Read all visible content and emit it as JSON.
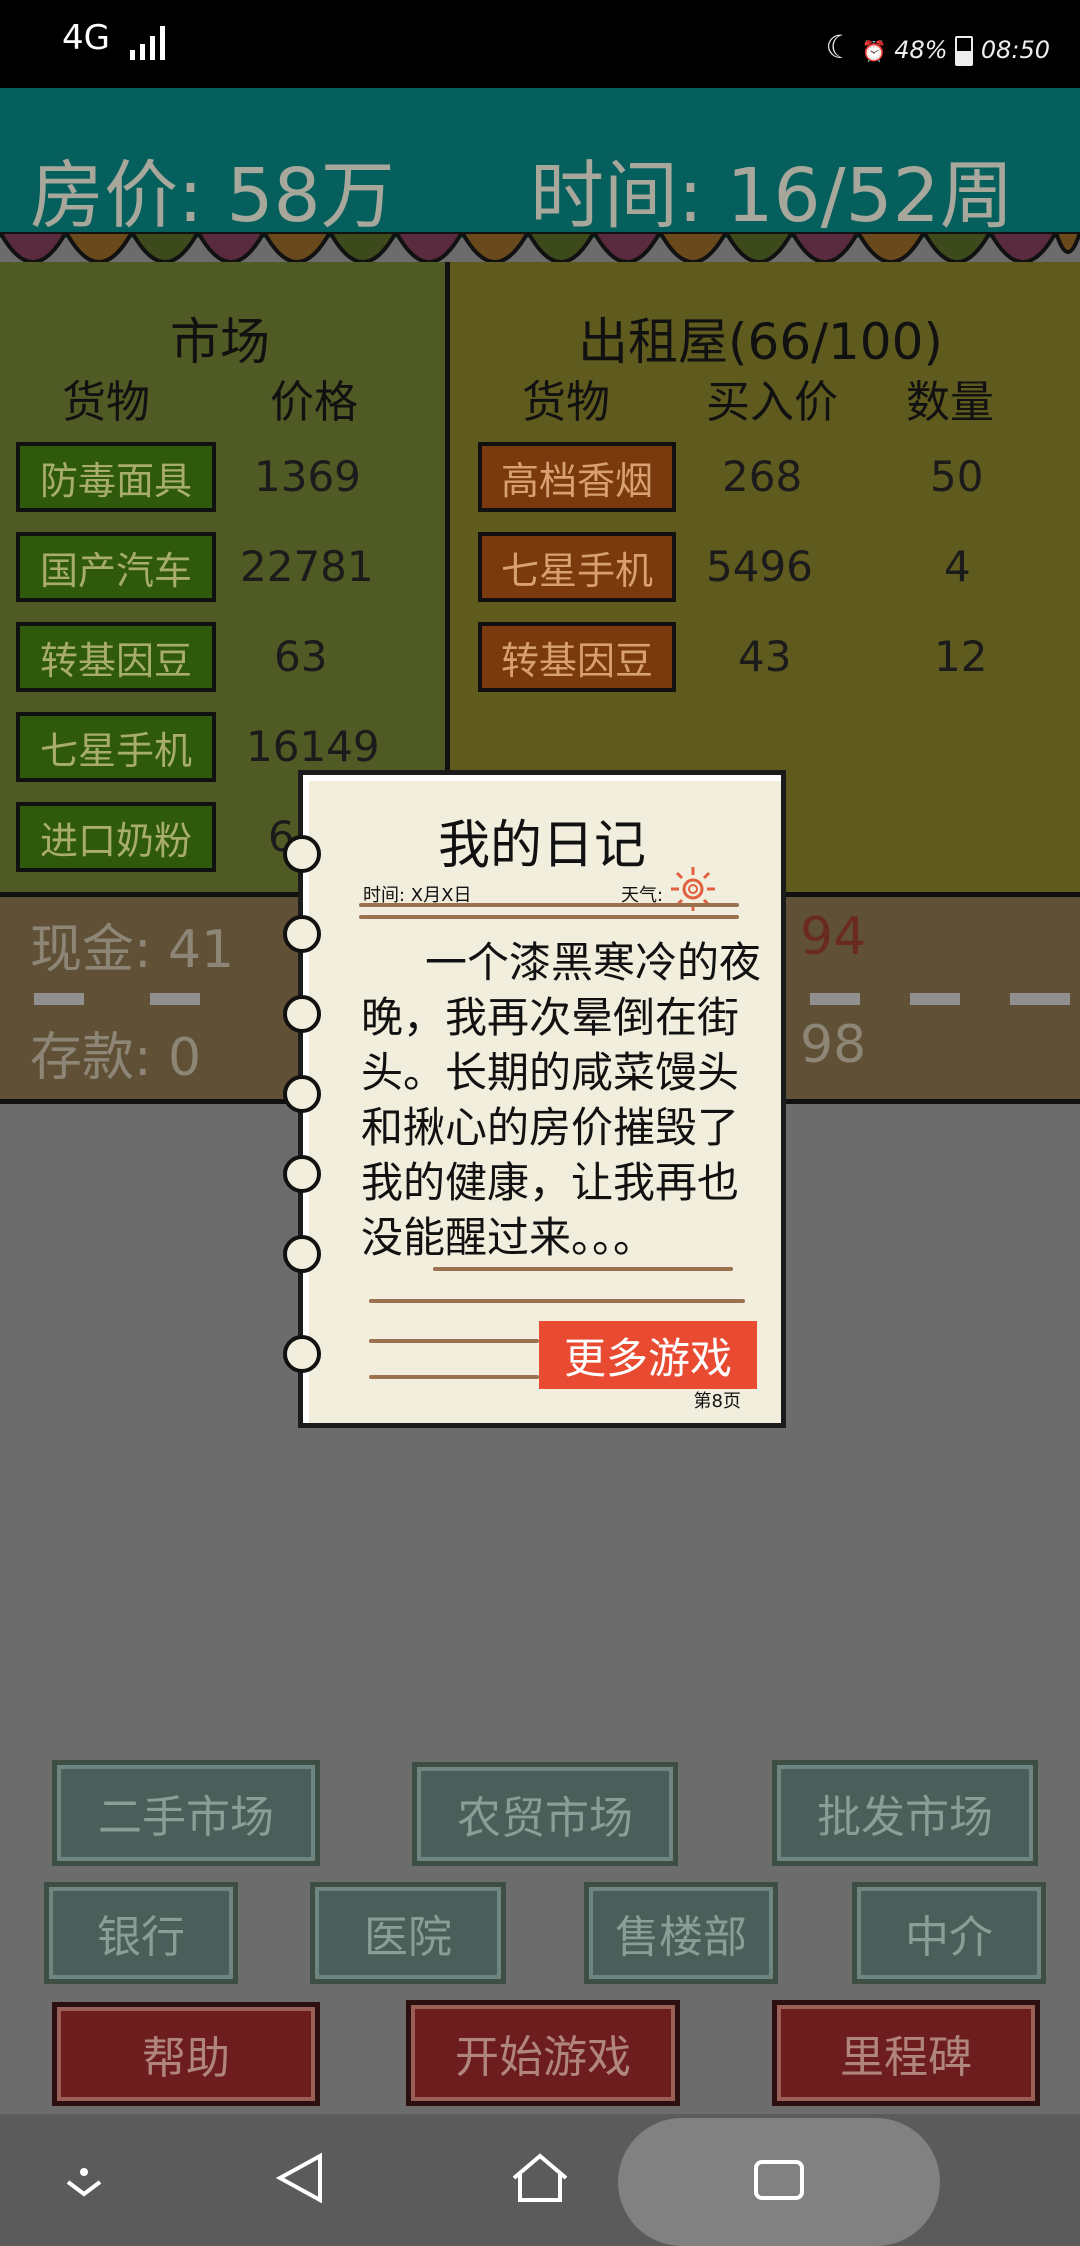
{
  "status_bar": {
    "network": "4G",
    "battery": "48%",
    "time": "08:50"
  },
  "header": {
    "house_price": "房价: 58万",
    "time": "时间: 16/52周"
  },
  "market": {
    "title": "市场",
    "col_goods": "货物",
    "col_price": "价格",
    "items": [
      {
        "name": "防毒面具",
        "price": "1369"
      },
      {
        "name": "国产汽车",
        "price": "22781"
      },
      {
        "name": "转基因豆",
        "price": "63"
      },
      {
        "name": "七星手机",
        "price": "16149"
      },
      {
        "name": "进口奶粉",
        "price": "6"
      }
    ]
  },
  "rental": {
    "title": "出租屋(66/100)",
    "col_goods": "货物",
    "col_buy": "买入价",
    "col_qty": "数量",
    "items": [
      {
        "name": "高档香烟",
        "buy": "268",
        "qty": "50"
      },
      {
        "name": "七星手机",
        "buy": "5496",
        "qty": "4"
      },
      {
        "name": "转基因豆",
        "buy": "43",
        "qty": "12"
      }
    ]
  },
  "finance": {
    "cash": "现金: 41",
    "deposit": "存款: 0",
    "cash_right": "94",
    "deposit_right": "98"
  },
  "buttons": {
    "row1": [
      "二手市场",
      "农贸市场",
      "批发市场"
    ],
    "row2": [
      "银行",
      "医院",
      "售楼部",
      "中介"
    ],
    "row3": [
      "帮助",
      "开始游戏",
      "里程碑"
    ]
  },
  "diary": {
    "title": "我的日记",
    "date": "时间: X月X日",
    "weather": "天气:",
    "body": "一个漆黑寒冷的夜晚，我再次晕倒在街头。长期的咸菜馒头和揪心的房价摧毁了我的健康，让我再也没能醒过来。。。",
    "more_games": "更多游戏",
    "page": "第8页"
  },
  "colors": {
    "header_bg": "#055f5c",
    "market_tag": "#2f5a0e",
    "rental_tag": "#7a3a0e",
    "more_games": "#e84b32"
  }
}
